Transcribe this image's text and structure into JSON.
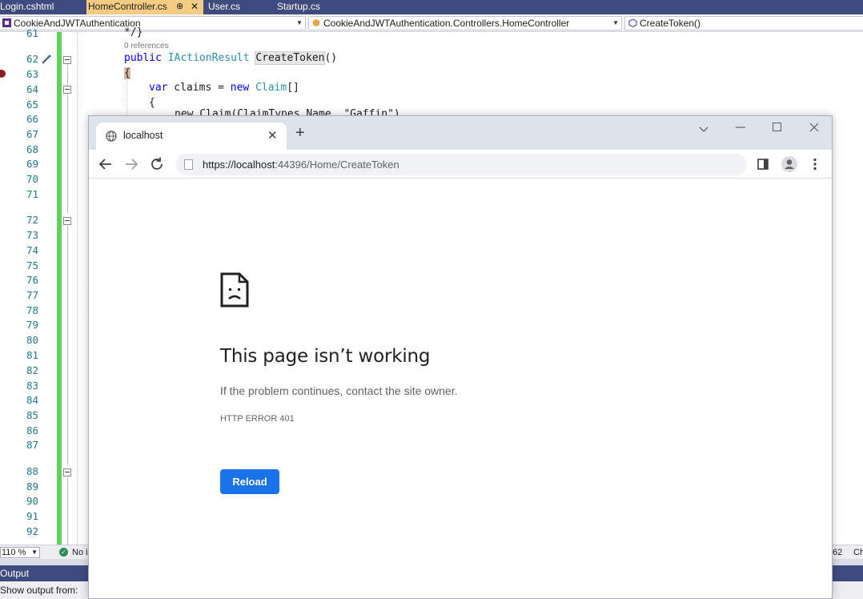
{
  "vs": {
    "tabs": [
      {
        "label": "Login.cshtml"
      },
      {
        "label": "HomeController.cs",
        "pin": "⊕",
        "close": "✕"
      },
      {
        "label": "User.cs"
      },
      {
        "label": "Startup.cs"
      }
    ],
    "nav": {
      "project": "CookieAndJWTAuthentication",
      "class": "CookieAndJWTAuthentication.Controllers.HomeController",
      "member": "CreateToken()"
    },
    "editor": {
      "line_numbers": [
        "61",
        "62",
        "63",
        "64",
        "65",
        "66",
        "67",
        "68",
        "69",
        "70",
        "71",
        "72",
        "73",
        "74",
        "75",
        "76",
        "77",
        "78",
        "79",
        "80",
        "81",
        "82",
        "83",
        "84",
        "85",
        "86",
        "87",
        "88",
        "89",
        "90",
        "91",
        "92"
      ],
      "top_fragment": "*/}",
      "references": "0 references",
      "code": {
        "l62_kw": "public",
        "l62_type": "IActionResult",
        "l62_method": "CreateToken",
        "l62_tail": "()",
        "l63": "{",
        "l64_kw1": "var",
        "l64_mid": " claims = ",
        "l64_kw2": "new",
        "l64_type": "Claim",
        "l64_tail": "[]",
        "l65": "{",
        "l66_partial": "new Claim(ClaimTypes.Name, \"Gaffin\"),"
      }
    },
    "status": {
      "zoom": "110 %",
      "issues": "No issues found",
      "line_col": "62",
      "encoding": "Ch"
    },
    "output": {
      "title": "Output",
      "show_from": "Show output from:"
    }
  },
  "browser": {
    "tab_title": "localhost",
    "url_host": "https://localhost",
    "url_rest": ":44396/Home/CreateToken",
    "error": {
      "title": "This page isn’t working",
      "message": "If the problem continues, contact the site owner.",
      "code": "HTTP ERROR 401",
      "button": "Reload"
    },
    "accent": "#1a73e8"
  }
}
